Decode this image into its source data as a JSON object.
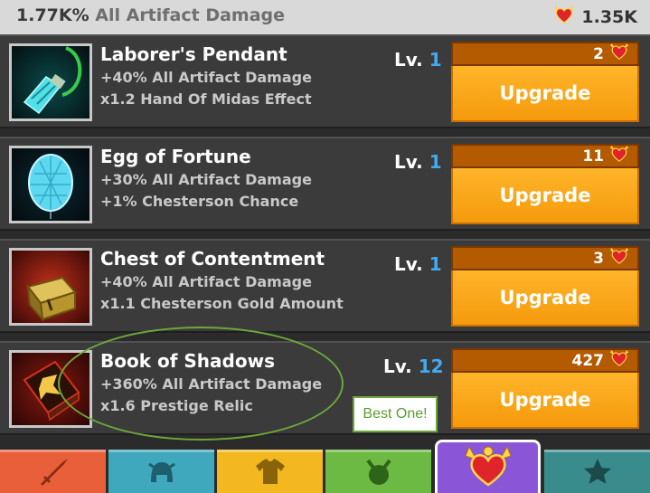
{
  "header": {
    "damage_value": "1.77K%",
    "damage_label": "All Artifact Damage",
    "relic_count": "1.35K"
  },
  "artifacts": [
    {
      "name": "Laborer's Pendant",
      "bonus1": "+40% All Artifact Damage",
      "bonus2": "x1.2 Hand Of Midas Effect",
      "lv_label": "Lv.",
      "level": "1",
      "cost": "2",
      "upgrade_label": "Upgrade",
      "icon": "pendant-icon"
    },
    {
      "name": "Egg of Fortune",
      "bonus1": "+30% All Artifact Damage",
      "bonus2": "+1% Chesterson Chance",
      "lv_label": "Lv.",
      "level": "1",
      "cost": "11",
      "upgrade_label": "Upgrade",
      "icon": "egg-icon"
    },
    {
      "name": "Chest of Contentment",
      "bonus1": "+40% All Artifact Damage",
      "bonus2": "x1.1 Chesterson Gold Amount",
      "lv_label": "Lv.",
      "level": "1",
      "cost": "3",
      "upgrade_label": "Upgrade",
      "icon": "chest-icon"
    },
    {
      "name": "Book of Shadows",
      "bonus1": "+360% All Artifact Damage",
      "bonus2": "x1.6 Prestige Relic",
      "lv_label": "Lv.",
      "level": "12",
      "cost": "427",
      "upgrade_label": "Upgrade",
      "icon": "book-icon"
    }
  ],
  "annotation": {
    "text": "Best One!",
    "color": "#6da83a"
  },
  "tabs": [
    {
      "name": "sword-icon",
      "color": "#e85f3a"
    },
    {
      "name": "helmet-icon",
      "color": "#3fa8bd"
    },
    {
      "name": "shirt-icon",
      "color": "#f3b820"
    },
    {
      "name": "horned-icon",
      "color": "#6cb944"
    },
    {
      "name": "relic-heart-icon",
      "color": "#8a55d6",
      "active": true
    },
    {
      "name": "star-icon",
      "color": "#3a8c8c"
    }
  ],
  "colors": {
    "upgrade_button": "#f5a31a",
    "cost_bar": "#b45a00",
    "level_number": "#44aaf0",
    "row_bg": "#3b3b3b"
  }
}
